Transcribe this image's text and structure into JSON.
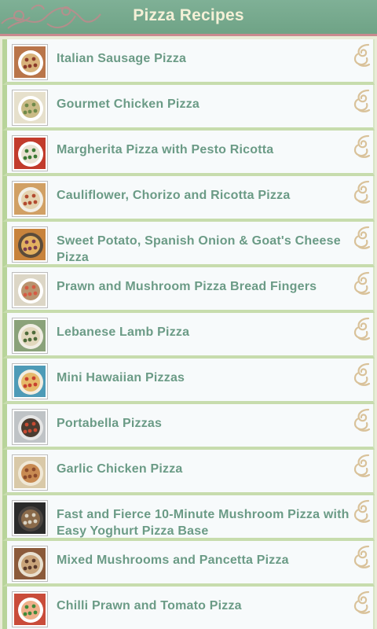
{
  "header": {
    "title": "Pizza Recipes"
  },
  "recipes": [
    {
      "title": "Italian Sausage Pizza",
      "bg": "#b9754a",
      "top": "#d8b27a",
      "accent": "#8b3a2a",
      "plate": "#ffffff"
    },
    {
      "title": "Gourmet Chicken Pizza",
      "bg": "#e6e0cc",
      "top": "#c9bb86",
      "accent": "#6f8a4a",
      "plate": "#ffffff"
    },
    {
      "title": "Margherita Pizza with Pesto Ricotta",
      "bg": "#c23b2c",
      "top": "#e9e2d2",
      "accent": "#3c7a35",
      "plate": "#ffffff"
    },
    {
      "title": "Cauliflower, Chorizo and Ricotta Pizza",
      "bg": "#d1a064",
      "top": "#e4d3b0",
      "accent": "#b24a2f",
      "plate": "#f2efe6"
    },
    {
      "title": "Sweet Potato, Spanish Onion & Goat's Cheese Pizza",
      "bg": "#c8833c",
      "top": "#e3b160",
      "accent": "#7a3b4f",
      "plate": "#5b4b3a"
    },
    {
      "title": "Prawn and Mushroom Pizza Bread Fingers",
      "bg": "#dcd6c6",
      "top": "#b99470",
      "accent": "#d65b44",
      "plate": "#ffffff"
    },
    {
      "title": "Lebanese Lamb Pizza",
      "bg": "#8aa27a",
      "top": "#e2d8bd",
      "accent": "#4e6b3a",
      "plate": "#f1eee4"
    },
    {
      "title": "Mini Hawaiian Pizzas",
      "bg": "#4e9bb7",
      "top": "#e6b96a",
      "accent": "#c8402f",
      "plate": "#f3ede0"
    },
    {
      "title": "Portabella Pizzas",
      "bg": "#bfc3c6",
      "top": "#4a3b30",
      "accent": "#c74a32",
      "plate": "#e6e6e6"
    },
    {
      "title": "Garlic Chicken Pizza",
      "bg": "#d9c9a8",
      "top": "#c88a52",
      "accent": "#8b4a2c",
      "plate": "#f0e8d6"
    },
    {
      "title": "Fast and Fierce 10-Minute Mushroom Pizza with Easy Yoghurt Pizza Base",
      "bg": "#2b2b2b",
      "top": "#8a6a4a",
      "accent": "#d9d3c4",
      "plate": "#4a4440"
    },
    {
      "title": "Mixed Mushrooms and Pancetta Pizza",
      "bg": "#8b5a3a",
      "top": "#c9a47a",
      "accent": "#5a3a2a",
      "plate": "#e9e1d0"
    },
    {
      "title": "Chilli Prawn and Tomato Pizza",
      "bg": "#c94c3a",
      "top": "#efb08a",
      "accent": "#3f8a3a",
      "plate": "#ffffff"
    }
  ]
}
